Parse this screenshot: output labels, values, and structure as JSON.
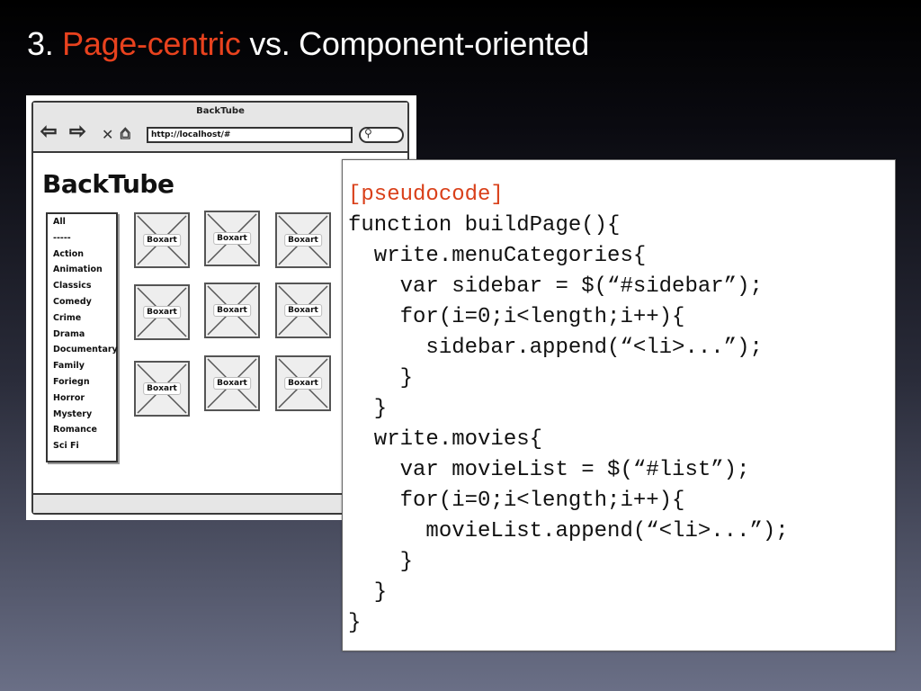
{
  "slide": {
    "title_prefix": "3. ",
    "title_accent": "Page-centric",
    "title_suffix": " vs. Component-oriented",
    "accent_color": "#e8421e"
  },
  "mockup": {
    "window_title": "BackTube",
    "url": "http://localhost/#",
    "app_title": "BackTube",
    "nav_icons": [
      "back-arrow-icon",
      "forward-arrow-icon",
      "close-icon",
      "home-icon",
      "search-icon"
    ],
    "sidebar_items": [
      "All",
      "-----",
      "Action",
      "Animation",
      "Classics",
      "Comedy",
      "Crime",
      "Drama",
      "Documentary",
      "Family",
      "Foriegn",
      "Horror",
      "Mystery",
      "Romance",
      "Sci Fi"
    ],
    "boxart_label": "Boxart",
    "boxart_count": 9
  },
  "code": {
    "lines": [
      "[pseudocode]",
      "function buildPage(){",
      "  write.menuCategories{",
      "    var sidebar = $(“#sidebar”);",
      "    for(i=0;i<length;i++){",
      "      sidebar.append(“<li>...”);",
      "    }",
      "  }",
      "  write.movies{",
      "    var movieList = $(“#list”);",
      "    for(i=0;i<length;i++){",
      "      movieList.append(“<li>...”);",
      "    }",
      "  }",
      "}"
    ],
    "comment_color": "#d9401a"
  }
}
